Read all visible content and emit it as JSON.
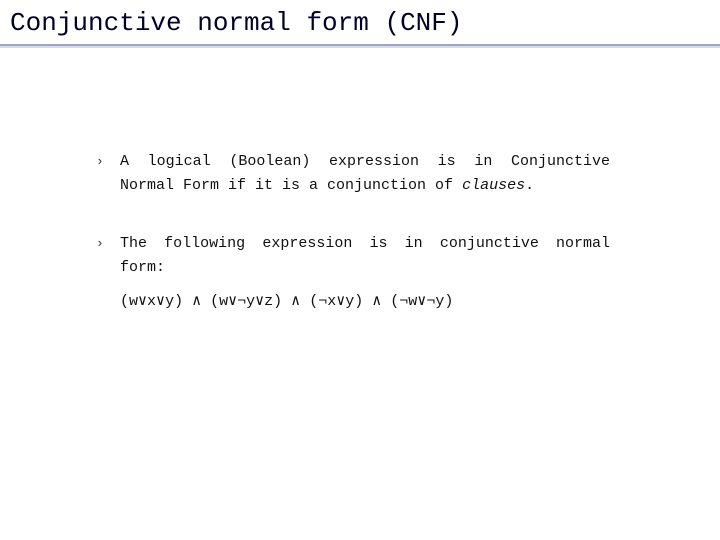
{
  "title": "Conjunctive normal form (CNF)",
  "bullets": {
    "b1": {
      "glyph": "›",
      "text_a": "A logical (Boolean) expression is in Conjunctive Normal Form if it is a conjunction of ",
      "text_b_italic": "clauses",
      "text_c": "."
    },
    "b2": {
      "glyph": "›",
      "text": "The following expression is in conjunctive normal form:",
      "formula": "(w∨x∨y) ∧ (w∨¬y∨z) ∧ (¬x∨y) ∧ (¬w∨¬y)"
    }
  }
}
